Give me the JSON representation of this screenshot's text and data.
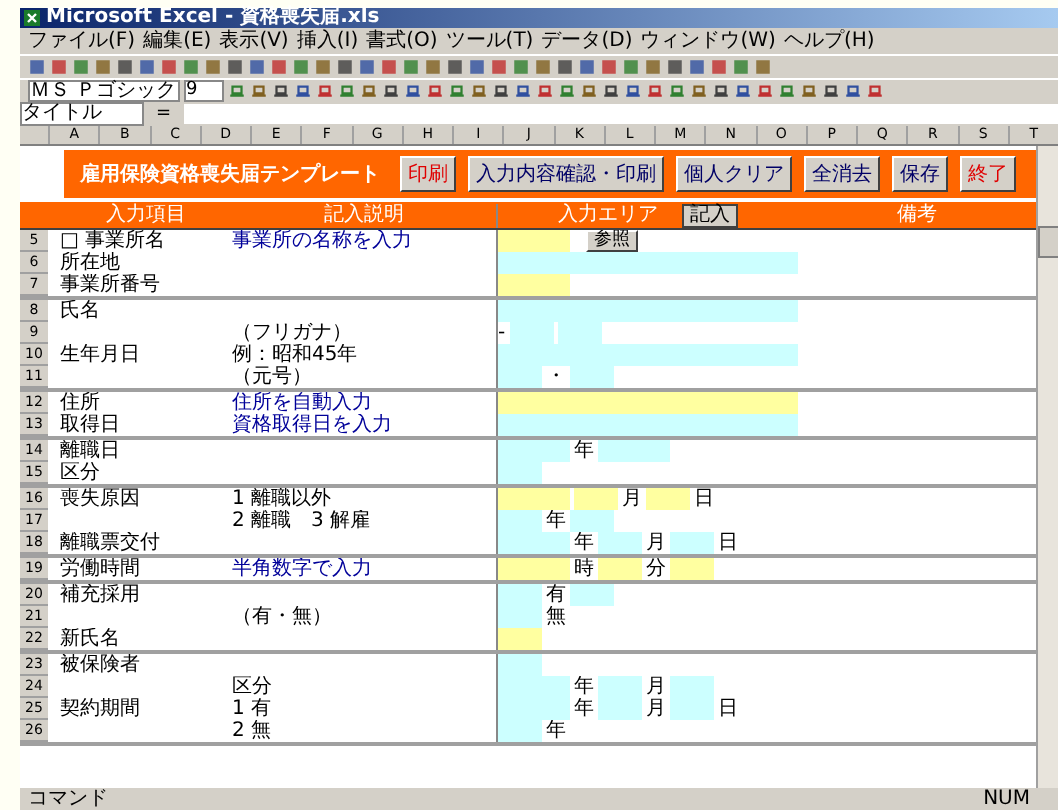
{
  "window": {
    "title": "Microsoft Excel - 資格喪失届.xls"
  },
  "menu": [
    "ファイル(F)",
    "編集(E)",
    "表示(V)",
    "挿入(I)",
    "書式(O)",
    "ツール(T)",
    "データ(D)",
    "ウィンドウ(W)",
    "ヘルプ(H)"
  ],
  "toolbar": {
    "font": "ＭＳ Ｐゴシック",
    "size": "9"
  },
  "formula_bar": {
    "name_box": "タイトル",
    "equals": "="
  },
  "columns": [
    "A",
    "B",
    "C",
    "D",
    "E",
    "F",
    "G",
    "H",
    "I",
    "J",
    "K",
    "L",
    "M",
    "N",
    "O",
    "P",
    "Q",
    "R",
    "S",
    "T"
  ],
  "form": {
    "title": "雇用保険資格喪失届テンプレート",
    "buttons": [
      {
        "label": "印刷",
        "alert": true
      },
      {
        "label": "入力内容確認・印刷",
        "alert": false
      },
      {
        "label": "個人クリア",
        "alert": false
      },
      {
        "label": "全消去",
        "alert": false
      },
      {
        "label": "保存",
        "alert": false
      },
      {
        "label": "終了",
        "alert": true
      }
    ],
    "headers": {
      "item": "入力項目",
      "note": "記入説明",
      "input": "入力エリア",
      "input_button": "記入",
      "remarks": "備考"
    },
    "rows": [
      {
        "num": "5",
        "label": "□ 事業所名",
        "note": "事業所の名称を入力",
        "note_help": true,
        "divider": false,
        "inputs": [
          {
            "kind": "field",
            "required": true
          }
        ],
        "button": "参照"
      },
      {
        "num": "6",
        "label": "所在地",
        "divider": false,
        "inputs": [
          {
            "kind": "wide",
            "required": false
          }
        ]
      },
      {
        "num": "7",
        "label": "事業所番号",
        "divider": true,
        "inputs": [
          {
            "kind": "field",
            "required": true
          }
        ]
      },
      {
        "num": "8",
        "label": "氏名",
        "divider": false,
        "inputs": [
          {
            "kind": "wide",
            "required": false
          }
        ]
      },
      {
        "num": "9",
        "note": "（フリガナ）",
        "note_help": false,
        "divider": false,
        "inputs": [
          {
            "kind": "mark",
            "text": "-"
          },
          {
            "kind": "short",
            "required": false
          },
          {
            "kind": "short",
            "required": false
          }
        ]
      },
      {
        "num": "10",
        "label": "生年月日",
        "note": "例：昭和45年",
        "note_help": false,
        "divider": false,
        "inputs": [
          {
            "kind": "wide",
            "required": false
          }
        ]
      },
      {
        "num": "11",
        "note": "（元号）",
        "note_help": false,
        "divider": true,
        "inputs": [
          {
            "kind": "short",
            "required": false
          },
          {
            "kind": "mark",
            "text": "・"
          },
          {
            "kind": "short",
            "required": false
          }
        ]
      },
      {
        "num": "12",
        "label": "住所",
        "note": "住所を自動入力",
        "note_help": true,
        "divider": false,
        "inputs": [
          {
            "kind": "wide",
            "required": true
          }
        ]
      },
      {
        "num": "13",
        "label": "取得日",
        "note": "資格取得日を入力",
        "note_help": true,
        "divider": true,
        "inputs": [
          {
            "kind": "wide",
            "required": false
          }
        ]
      },
      {
        "num": "14",
        "label": "離職日",
        "divider": false,
        "inputs": [
          {
            "kind": "field",
            "required": false
          },
          {
            "kind": "mark",
            "text": "年"
          },
          {
            "kind": "field",
            "required": false
          }
        ]
      },
      {
        "num": "15",
        "label": "区分",
        "divider": true,
        "inputs": [
          {
            "kind": "short",
            "required": false
          }
        ]
      },
      {
        "num": "16",
        "label": "喪失原因",
        "note": "1 離職以外",
        "note_help": false,
        "divider": false,
        "inputs": [
          {
            "kind": "field",
            "required": true
          },
          {
            "kind": "short",
            "required": true
          },
          {
            "kind": "mark",
            "text": "月"
          },
          {
            "kind": "short",
            "required": true
          },
          {
            "kind": "mark",
            "text": "日"
          }
        ]
      },
      {
        "num": "17",
        "note": "2 離職　3 解雇",
        "note_help": false,
        "divider": false,
        "inputs": [
          {
            "kind": "short",
            "required": false
          },
          {
            "kind": "mark",
            "text": "年"
          },
          {
            "kind": "short",
            "required": false
          }
        ]
      },
      {
        "num": "18",
        "label": "離職票交付",
        "divider": true,
        "inputs": [
          {
            "kind": "field",
            "required": false
          },
          {
            "kind": "mark",
            "text": "年"
          },
          {
            "kind": "short",
            "required": false
          },
          {
            "kind": "mark",
            "text": "月"
          },
          {
            "kind": "short",
            "required": false
          },
          {
            "kind": "mark",
            "text": "日"
          }
        ]
      },
      {
        "num": "19",
        "label": "労働時間",
        "note": "半角数字で入力",
        "note_help": true,
        "divider": true,
        "inputs": [
          {
            "kind": "field",
            "required": true
          },
          {
            "kind": "mark",
            "text": "時"
          },
          {
            "kind": "short",
            "required": true
          },
          {
            "kind": "mark",
            "text": "分"
          },
          {
            "kind": "short",
            "required": true
          }
        ]
      },
      {
        "num": "20",
        "label": "補充採用",
        "divider": false,
        "inputs": [
          {
            "kind": "short",
            "required": false
          },
          {
            "kind": "mark",
            "text": "有"
          },
          {
            "kind": "short",
            "required": false
          }
        ]
      },
      {
        "num": "21",
        "note": "（有・無）",
        "note_help": false,
        "divider": false,
        "inputs": [
          {
            "kind": "short",
            "required": false
          },
          {
            "kind": "mark",
            "text": "無"
          }
        ]
      },
      {
        "num": "22",
        "label": "新氏名",
        "divider": true,
        "inputs": [
          {
            "kind": "short",
            "required": true
          }
        ]
      },
      {
        "num": "23",
        "label": "被保険者",
        "divider": false,
        "inputs": [
          {
            "kind": "short",
            "required": false
          }
        ]
      },
      {
        "num": "24",
        "note": "区分",
        "note_help": false,
        "divider": false,
        "inputs": [
          {
            "kind": "field",
            "required": false
          },
          {
            "kind": "mark",
            "text": "年"
          },
          {
            "kind": "short",
            "required": false
          },
          {
            "kind": "mark",
            "text": "月"
          },
          {
            "kind": "short",
            "required": false
          }
        ]
      },
      {
        "num": "25",
        "label": "契約期間",
        "note": "1 有",
        "note_help": false,
        "divider": false,
        "inputs": [
          {
            "kind": "field",
            "required": false
          },
          {
            "kind": "mark",
            "text": "年"
          },
          {
            "kind": "short",
            "required": false
          },
          {
            "kind": "mark",
            "text": "月"
          },
          {
            "kind": "short",
            "required": false
          },
          {
            "kind": "mark",
            "text": "日"
          }
        ]
      },
      {
        "num": "26",
        "note": "2 無",
        "note_help": false,
        "divider": true,
        "inputs": [
          {
            "kind": "short",
            "required": false
          },
          {
            "kind": "mark",
            "text": "年"
          }
        ]
      }
    ]
  },
  "status_bar": {
    "left": "コマンド",
    "right": "NUM"
  }
}
